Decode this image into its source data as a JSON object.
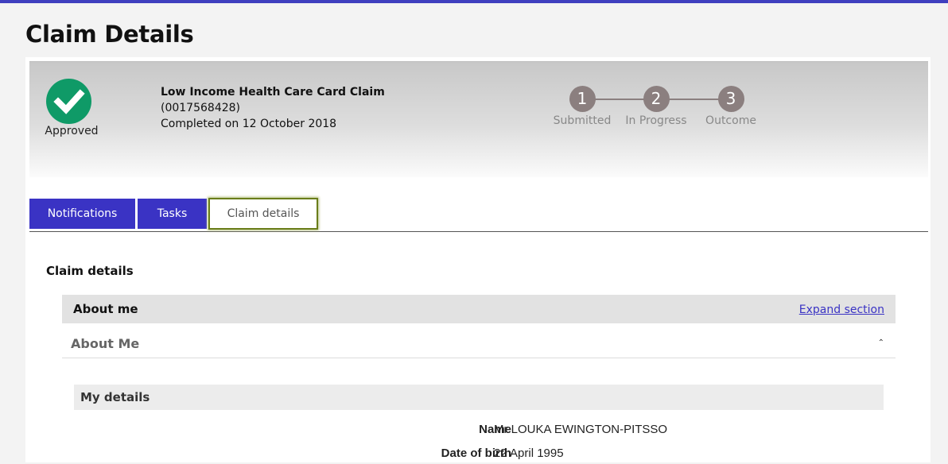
{
  "page": {
    "title": "Claim Details"
  },
  "summary": {
    "status": "Approved",
    "claim_title": "Low Income Health Care Card Claim",
    "claim_ref": "(0017568428)",
    "completed": "Completed on 12 October 2018",
    "status_icon": "check-circle-icon",
    "colors": {
      "approved": "#0f9a67",
      "step": "#8b7f7f"
    }
  },
  "progress": {
    "steps": [
      {
        "number": "1",
        "label": "Submitted"
      },
      {
        "number": "2",
        "label": "In Progress"
      },
      {
        "number": "3",
        "label": "Outcome"
      }
    ]
  },
  "tabs": [
    {
      "label": "Notifications",
      "active": false
    },
    {
      "label": "Tasks",
      "active": false
    },
    {
      "label": "Claim details",
      "active": true
    }
  ],
  "claim_details": {
    "heading": "Claim details",
    "section_title": "About me",
    "expand_link": "Expand section",
    "subsection_title": "About Me",
    "panel_title": "My details",
    "fields": [
      {
        "label": "Name",
        "value": "Mr LOUKA EWINGTON-PITSSO"
      },
      {
        "label": "Date of birth",
        "value": "22 April 1995"
      }
    ]
  },
  "accent_color": "#3a33c4"
}
